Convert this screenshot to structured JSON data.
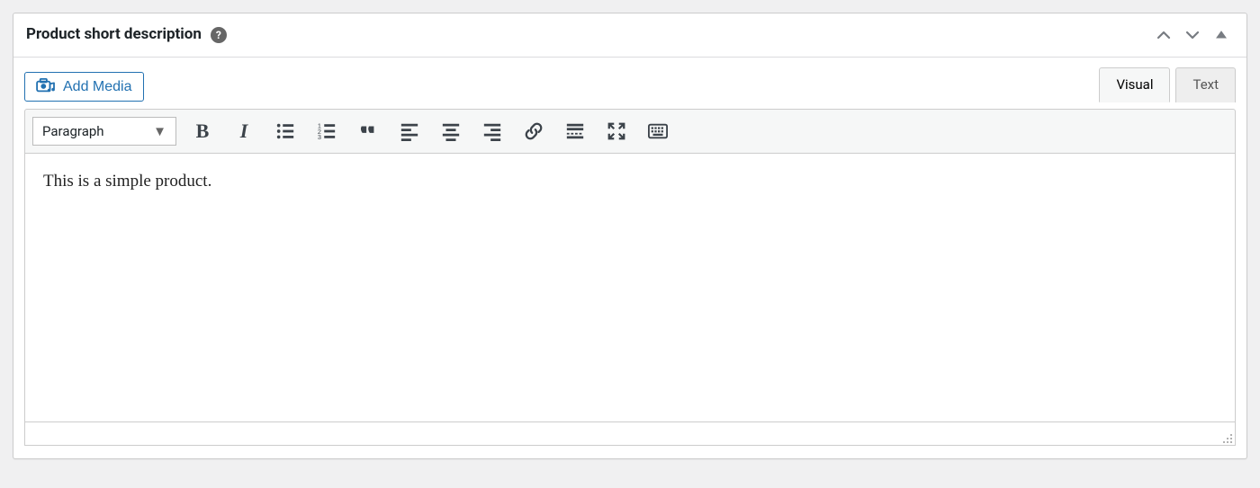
{
  "panel": {
    "title": "Product short description",
    "help_label": "?"
  },
  "media_button": {
    "label": "Add Media"
  },
  "tabs": {
    "visual": "Visual",
    "text": "Text",
    "active": "visual"
  },
  "toolbar": {
    "format_select": "Paragraph",
    "buttons": {
      "bold": "B",
      "italic": "I"
    }
  },
  "editor": {
    "content": "This is a simple product."
  }
}
